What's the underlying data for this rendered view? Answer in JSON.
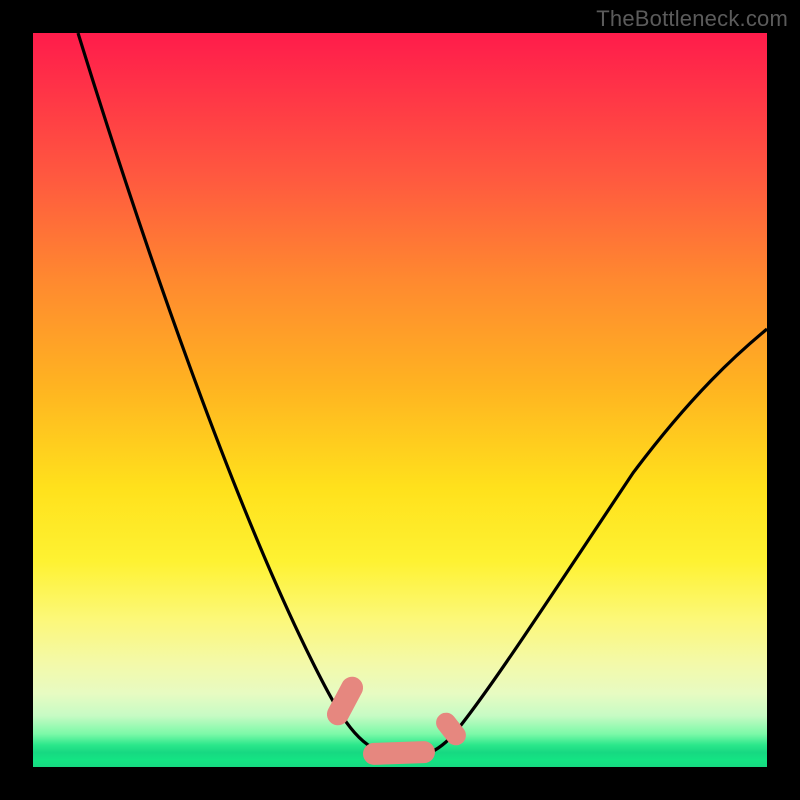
{
  "watermark": "TheBottleneck.com",
  "colors": {
    "background": "#000000",
    "curve": "#000000",
    "lozenge": "#e6877f",
    "gradient_top": "#ff1c4b",
    "gradient_bottom": "#16d981"
  },
  "chart_data": {
    "type": "line",
    "title": "",
    "xlabel": "",
    "ylabel": "",
    "xlim": [
      0,
      100
    ],
    "ylim": [
      0,
      100
    ],
    "grid": false,
    "legend": false,
    "note": "Axes are unlabeled in the image; values below are estimated percentages read from pixel positions along each axis. y=0 is the bottom edge (green), y=100 is the top (red).",
    "series": [
      {
        "name": "bottleneck-curve",
        "x": [
          6,
          10,
          14,
          18,
          22,
          26,
          30,
          34,
          38,
          41,
          44,
          47,
          50,
          53,
          56,
          60,
          64,
          70,
          76,
          82,
          88,
          94,
          100
        ],
        "y": [
          100,
          87,
          75,
          63,
          52,
          42,
          33,
          25,
          17,
          11,
          6,
          3,
          1,
          1,
          2,
          5,
          11,
          19,
          29,
          38,
          47,
          54,
          60
        ]
      }
    ],
    "annotations": [
      {
        "name": "lozenge-left",
        "shape": "rounded-bar",
        "x_center": 43,
        "y_center": 5,
        "angle_deg": -65
      },
      {
        "name": "lozenge-middle",
        "shape": "rounded-bar",
        "x_center": 50,
        "y_center": 1.5,
        "angle_deg": 0
      },
      {
        "name": "lozenge-right",
        "shape": "rounded-bar",
        "x_center": 57,
        "y_center": 5,
        "angle_deg": 55
      }
    ]
  }
}
